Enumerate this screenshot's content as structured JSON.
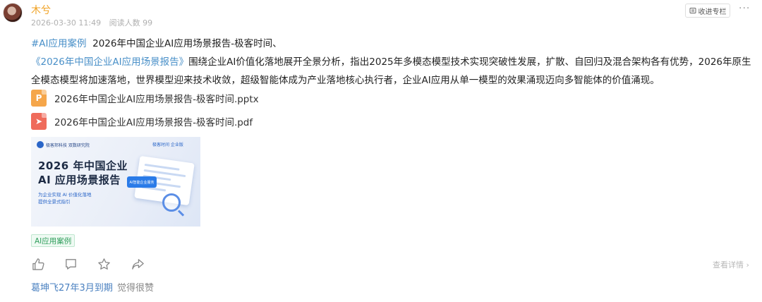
{
  "post": {
    "author": "木兮",
    "date": "2026-03-30 11:49",
    "read_count": "阅读人数 99",
    "collect_label": "收进专栏",
    "more_label": "···",
    "hashtag": "#AI应用案例",
    "headline": "2026年中国企业AI应用场景报告-极客时间、",
    "book_title": "《2026年中国企业AI应用场景报告》",
    "body": "围绕企业AI价值化落地展开全景分析，指出2025年多模态模型技术实现突破性发展，扩散、自回归及混合架构各有优势，2026年原生全模态模型将加速落地，世界模型迎来技术收敛，超级智能体成为产业落地核心执行者，企业AI应用从单一模型的效果涌现迈向多智能体的价值涌现。"
  },
  "attachments": [
    {
      "name": "2026年中国企业AI应用场景报告-极客时间.pptx",
      "type": "pptx",
      "icon": "ppt-file-icon",
      "color": "#f5a64a",
      "glyph": "P"
    },
    {
      "name": "2026年中国企业AI应用场景报告-极客时间.pdf",
      "type": "pdf",
      "icon": "pdf-file-icon",
      "color": "#ef6b5b",
      "glyph": "➤"
    }
  ],
  "cover": {
    "logo_left": "极客邦科技 双数研究院",
    "logo_right": "极客时间 企业版",
    "title_line1": "2026 年中国企业",
    "title_line2": "AI 应用场景报告",
    "subtitle_line1": "为企业实现 AI 价值化落地",
    "subtitle_line2": "提供全景式指引",
    "chip_text": "AI智能企业服务"
  },
  "tag_label": "AI应用案例",
  "actions": {
    "like_icon": "thumbs-up-icon",
    "comment_icon": "comment-icon",
    "star_icon": "star-icon",
    "share_icon": "share-icon",
    "more_detail": "查看详情"
  },
  "comment": {
    "user": "葛坤飞27年3月到期",
    "text": "觉得很赞"
  },
  "colors": {
    "author": "#f0a020",
    "link": "#4a90c8",
    "tag_text": "#2e9d5b",
    "tag_bg": "#effaf3"
  }
}
